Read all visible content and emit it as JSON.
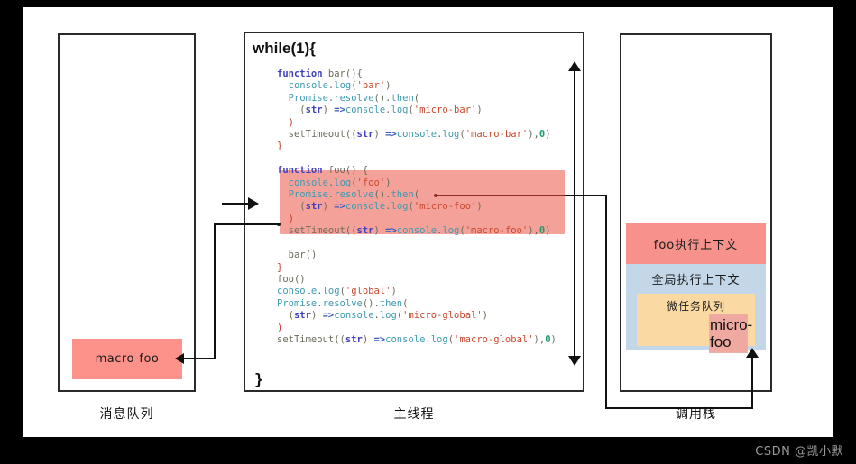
{
  "figure": {
    "background_color": "#000000",
    "canvas_color": "#ffffff",
    "watermark": "CSDN @凯小默"
  },
  "regions": [
    {
      "key": "message_queue",
      "label": "消息队列"
    },
    {
      "key": "main_thread",
      "label": "主线程"
    },
    {
      "key": "call_stack",
      "label": "调用栈"
    }
  ],
  "main_thread": {
    "loop_open": "while(1){",
    "loop_close": "}",
    "code_lines": [
      "function bar(){",
      "  console.log('bar')",
      "  Promise.resolve().then(",
      "    (str) =>console.log('micro-bar')",
      "  )",
      "  setTimeout((str) =>console.log('macro-bar'),0)",
      "}",
      "",
      "function foo() {",
      "  console.log('foo')",
      "  Promise.resolve().then(",
      "    (str) =>console.log('micro-foo')",
      "  )",
      "  setTimeout((str) =>console.log('macro-foo'),0)",
      "",
      "  bar()",
      "}",
      "foo()",
      "console.log('global')",
      "Promise.resolve().then(",
      "  (str) =>console.log('micro-global')",
      ")",
      "setTimeout((str) =>console.log('macro-global'),0)"
    ],
    "highlight_color": "#f4a19a",
    "highlighted_lines": [
      "console.log('foo')",
      "Promise.resolve().then(",
      "  (str) =>console.log('micro-foo')",
      ")",
      "setTimeout((str) =>console.log('macro-foo'),0)"
    ]
  },
  "message_queue": {
    "task_label": "macro-foo",
    "task_color": "#fc9289"
  },
  "call_stack": {
    "frames": [
      {
        "label": "foo执行上下文",
        "color": "#f6918b"
      },
      {
        "label": "全局执行上下文",
        "color": "#c3d7e8"
      }
    ],
    "microtask_queue": {
      "label": "微任务队列",
      "color": "#fbd9a2"
    },
    "microtask_item": "micro-\nfoo"
  },
  "code_colors": {
    "keyword": "#4040c0",
    "object": "#3e9ab0",
    "string": "#c94a2e",
    "arrow": "#3b5bbf",
    "number": "#1f9a6e",
    "plain": "#6b6b5a",
    "punct": "#c0392b"
  }
}
